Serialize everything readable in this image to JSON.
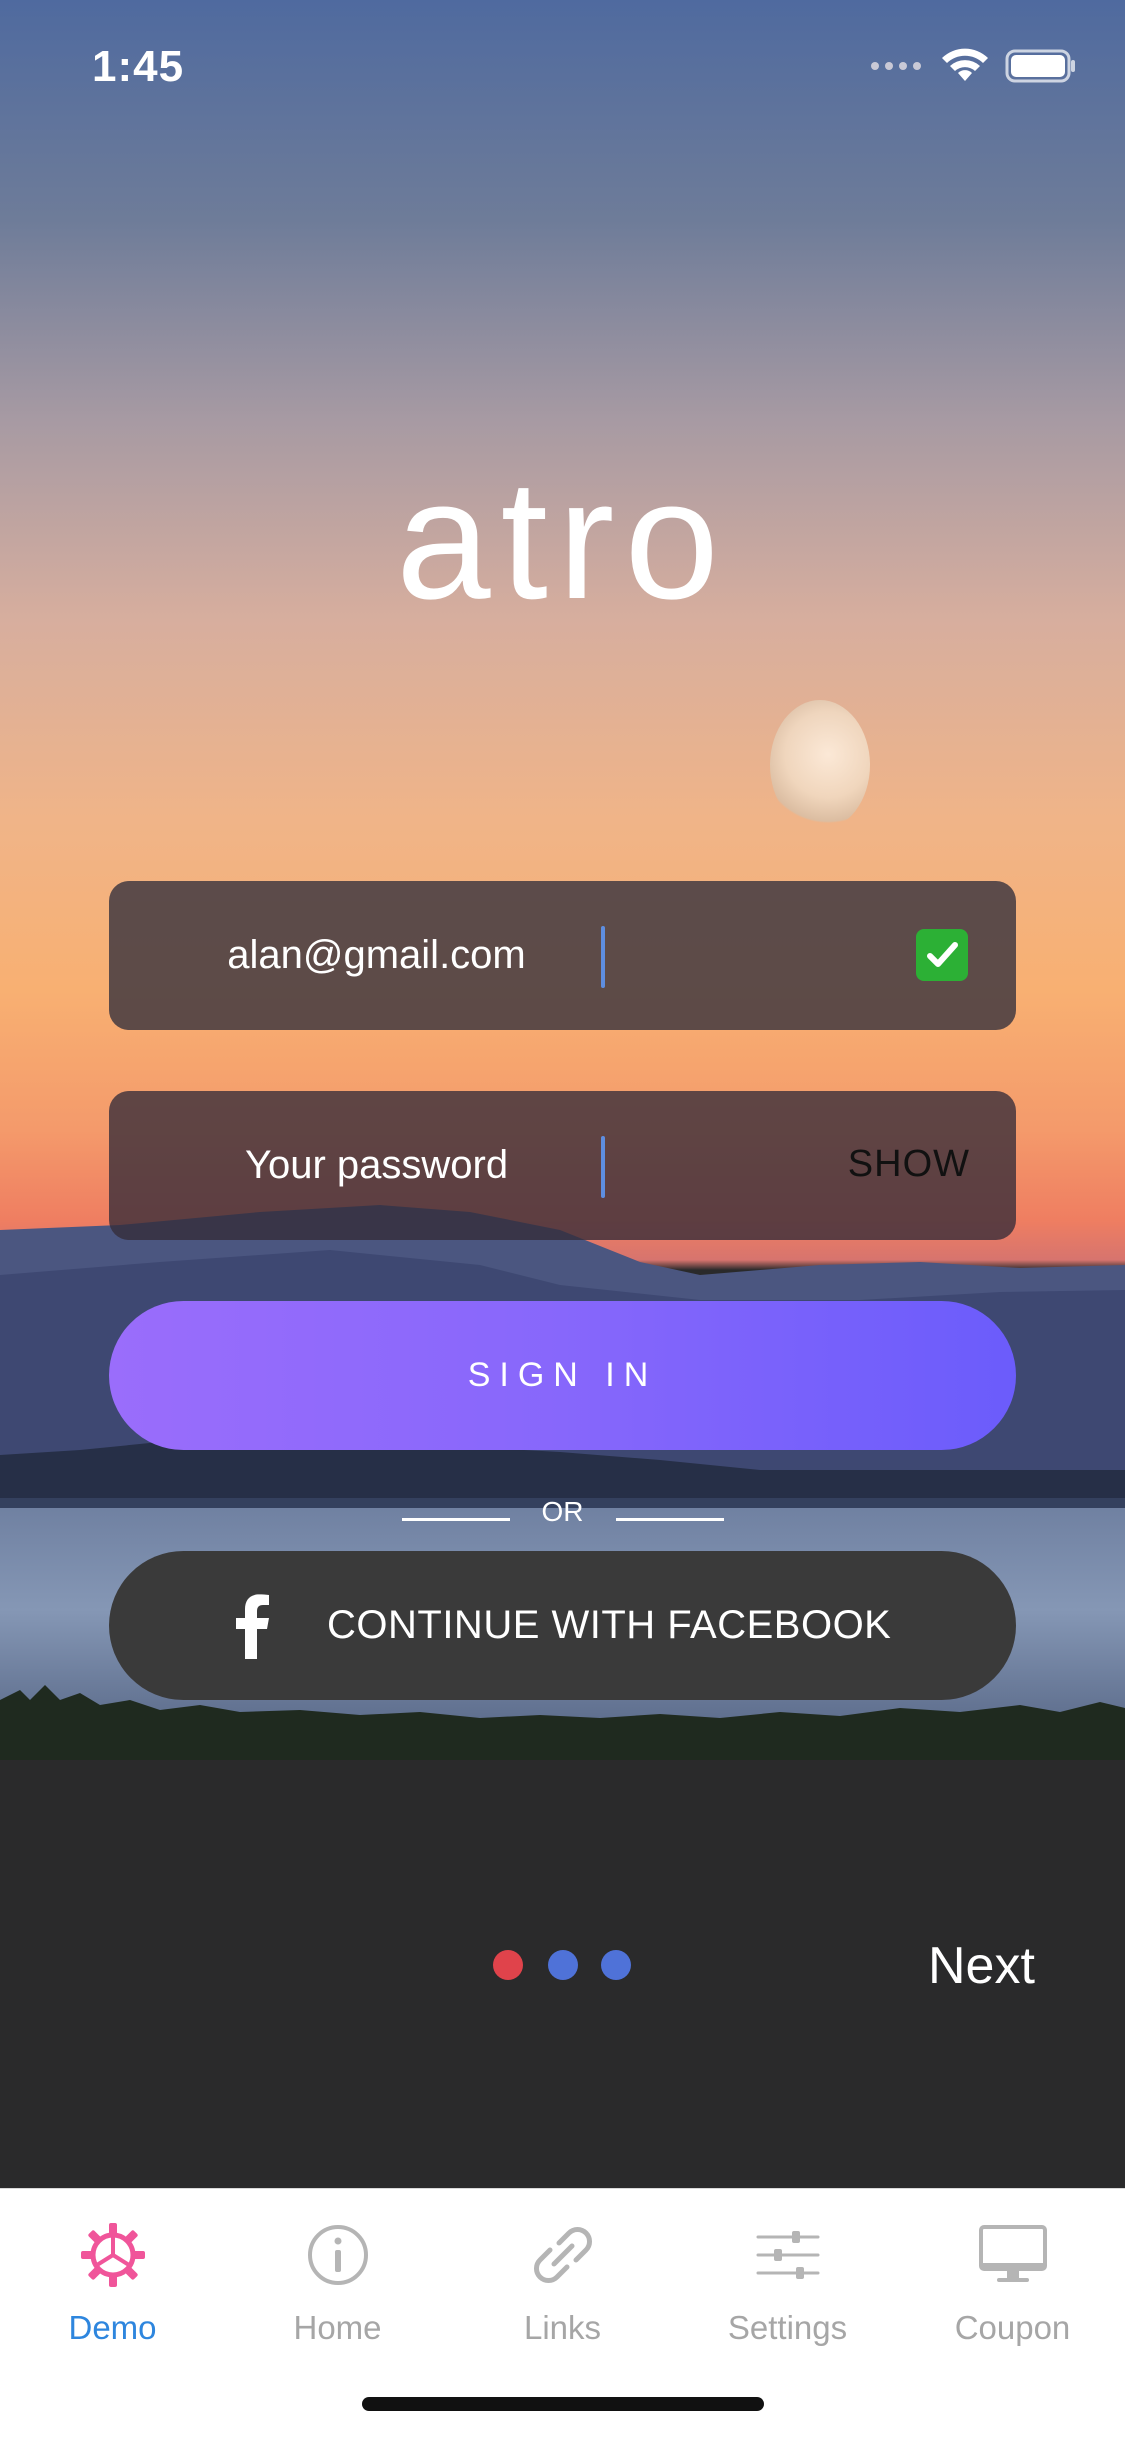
{
  "status_bar": {
    "time": "1:45"
  },
  "logo": {
    "text": "atro"
  },
  "email_field": {
    "value": "alan@gmail.com",
    "valid_icon": "check-mark-icon"
  },
  "password_field": {
    "placeholder": "Your password",
    "toggle_label": "SHOW"
  },
  "sign_in_button": {
    "label": "SIGN IN"
  },
  "divider": {
    "label": "OR"
  },
  "facebook_button": {
    "label": "CONTINUE WITH FACEBOOK",
    "icon": "facebook-icon"
  },
  "pager": {
    "dots": [
      "#e0434b",
      "#4f72d8",
      "#4f72d8"
    ],
    "next_label": "Next"
  },
  "tab_bar": {
    "tabs": [
      {
        "label": "Demo",
        "icon": "gear-icon",
        "active": true
      },
      {
        "label": "Home",
        "icon": "info-icon",
        "active": false
      },
      {
        "label": "Links",
        "icon": "link-icon",
        "active": false
      },
      {
        "label": "Settings",
        "icon": "sliders-icon",
        "active": false
      },
      {
        "label": "Coupon",
        "icon": "monitor-icon",
        "active": false
      }
    ]
  },
  "colors": {
    "accent": "#2e86de",
    "active_icon": "#f0559a",
    "sign_in_gradient_start": "#9a6dfb",
    "sign_in_gradient_end": "#6b5cfb"
  }
}
